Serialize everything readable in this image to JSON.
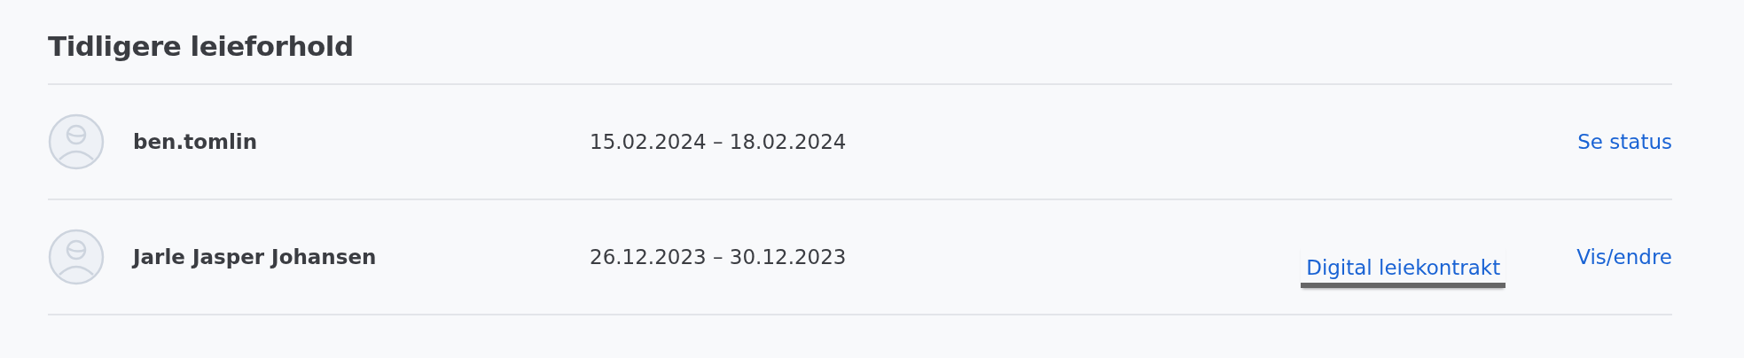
{
  "heading": "Tidligere leieforhold",
  "rentals": [
    {
      "name": "ben.tomlin",
      "period": "15.02.2024 – 18.02.2024",
      "actions": [
        {
          "label": "Se status",
          "focused": false
        }
      ]
    },
    {
      "name": "Jarle Jasper Johansen",
      "period": "26.12.2023 – 30.12.2023",
      "actions": [
        {
          "label": "Digital leiekontrakt",
          "focused": true
        },
        {
          "label": "Vis/endre",
          "focused": false
        }
      ]
    }
  ]
}
